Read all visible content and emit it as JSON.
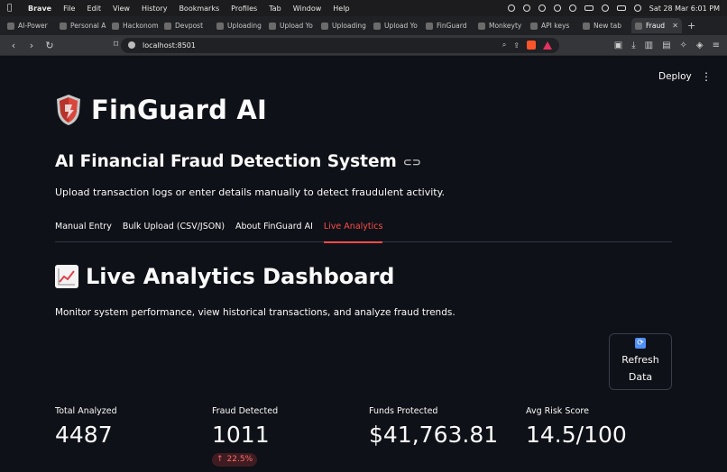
{
  "menubar": {
    "items": [
      "Brave",
      "File",
      "Edit",
      "View",
      "History",
      "Bookmarks",
      "Profiles",
      "Tab",
      "Window",
      "Help"
    ],
    "clock": "Sat 28 Mar  6:01 PM"
  },
  "browser_tabs": [
    "AI-Power",
    "Personal A",
    "Hackonom",
    "Devpost",
    "Uploading",
    "Upload Yo",
    "Uploading",
    "Upload Yo",
    "FinGuard",
    "Monkeyty",
    "API keys",
    "New tab",
    "Fraud"
  ],
  "address_bar": {
    "url": "localhost:8501"
  },
  "app": {
    "deploy_label": "Deploy",
    "menu_glyph": "⋮",
    "title": "FinGuard AI",
    "subheader": "AI Financial Fraud Detection System",
    "description": "Upload transaction logs or enter details manually to detect fraudulent activity.",
    "tabs": [
      "Manual Entry",
      "Bulk Upload (CSV/JSON)",
      "About FinGuard AI",
      "Live Analytics"
    ],
    "active_tab": "Live Analytics",
    "dashboard_title": "Live Analytics Dashboard",
    "dashboard_caption": "Monitor system performance, view historical transactions, and analyze fraud trends.",
    "refresh_button": "Refresh Data",
    "metrics": [
      {
        "label": "Total Analyzed",
        "value": "4487"
      },
      {
        "label": "Fraud Detected",
        "value": "1011",
        "delta": "22.5%",
        "delta_arrow": "↑"
      },
      {
        "label": "Funds Protected",
        "value": "$41,763.81"
      },
      {
        "label": "Avg Risk Score",
        "value": "14.5/100"
      }
    ]
  },
  "colors": {
    "background": "#0e1117",
    "accent": "#ff4b4b",
    "text": "#fafafa"
  }
}
